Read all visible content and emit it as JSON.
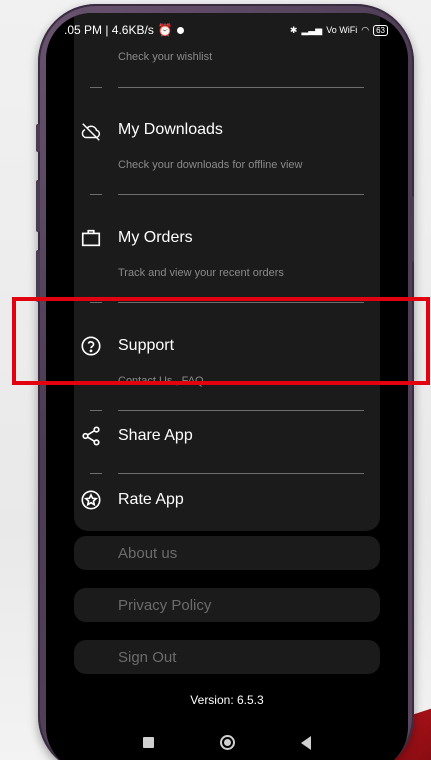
{
  "status_bar": {
    "time_speed": ".05 PM | 4.6KB/s",
    "network": "Vo WiFi",
    "battery": "63"
  },
  "menu": {
    "wishlist_sub": "Check your wishlist",
    "downloads": {
      "title": "My Downloads",
      "sub": "Check your downloads for offline view"
    },
    "orders": {
      "title": "My Orders",
      "sub": "Track and view your recent orders"
    },
    "support": {
      "title": "Support",
      "sub": "Contact Us , FAQ"
    },
    "share": {
      "title": "Share App"
    },
    "rate": {
      "title": "Rate App"
    }
  },
  "links": {
    "about": "About us",
    "privacy": "Privacy Policy",
    "signout": "Sign Out"
  },
  "version": "Version: 6.5.3",
  "colors": {
    "highlight": "#e3000f",
    "card": "#1b1b1b",
    "phone_frame": "#5b4860"
  }
}
